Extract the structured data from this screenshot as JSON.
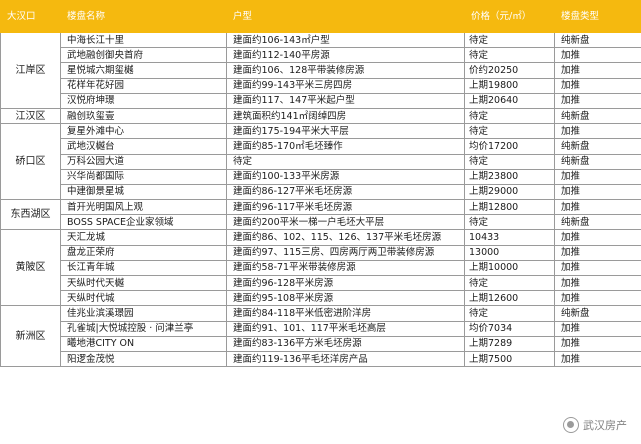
{
  "header": {
    "district": "大汉口",
    "name": "楼盘名称",
    "type": "户型",
    "price": "价格（元/㎡）",
    "category": "楼盘类型"
  },
  "groups": [
    {
      "district": "江岸区",
      "rows": [
        {
          "name": "中海长江十里",
          "type": "建面约106-143㎡户型",
          "price": "待定",
          "category": "纯新盘"
        },
        {
          "name": "武地融创御央首府",
          "type": "建面约112-140平房源",
          "price": "待定",
          "category": "加推"
        },
        {
          "name": "星悦城六期玺樾",
          "type": "建面约106、128平带装修房源",
          "price": "价约20250",
          "category": "加推"
        },
        {
          "name": "花样年花好园",
          "type": "建面约99-143平米三房四房",
          "price": "上期19800",
          "category": "加推"
        },
        {
          "name": "汉悦府坤璟",
          "type": "建面约117、147平米起户型",
          "price": "上期20640",
          "category": "加推"
        }
      ]
    },
    {
      "district": "江汉区",
      "rows": [
        {
          "name": "融创玖玺壹",
          "type": "建筑面积约141㎡阔绰四房",
          "price": "待定",
          "category": "纯新盘"
        }
      ]
    },
    {
      "district": "硚口区",
      "rows": [
        {
          "name": "复星外滩中心",
          "type": "建面约175-194平米大平层",
          "price": "待定",
          "category": "加推"
        },
        {
          "name": "武地汉樾台",
          "type": "建面约85-170㎡毛坯臻作",
          "price": "均价17200",
          "category": "纯新盘"
        },
        {
          "name": "万科公园大道",
          "type": "待定",
          "price": "待定",
          "category": "纯新盘"
        },
        {
          "name": "兴华尚都国际",
          "type": "建面约100-133平米房源",
          "price": "上期23800",
          "category": "加推"
        },
        {
          "name": "中建御景星城",
          "type": "建面约86-127平米毛坯房源",
          "price": "上期29000",
          "category": "加推"
        }
      ]
    },
    {
      "district": "东西湖区",
      "rows": [
        {
          "name": "首开光明国风上观",
          "type": "建面约96-117平米毛坯房源",
          "price": "上期12800",
          "category": "加推"
        },
        {
          "name": "BOSS SPACE企业家领域",
          "type": "建面约200平米一梯一户毛坯大平层",
          "price": "待定",
          "category": "纯新盘"
        }
      ]
    },
    {
      "district": "黄陂区",
      "rows": [
        {
          "name": "天汇龙城",
          "type": "建面约86、102、115、126、137平米毛坯房源",
          "price": "10433",
          "category": "加推"
        },
        {
          "name": "盘龙正荣府",
          "type": "建面约97、115三房、四房两厅两卫带装修房源",
          "price": "13000",
          "category": "加推"
        },
        {
          "name": "长江青年城",
          "type": "建面约58-71平米带装修房源",
          "price": "上期10000",
          "category": "加推"
        },
        {
          "name": "天纵时代天樾",
          "type": "建面约96-128平米房源",
          "price": "待定",
          "category": "加推"
        },
        {
          "name": "天纵时代城",
          "type": "建面约95-108平米房源",
          "price": "上期12600",
          "category": "加推"
        }
      ]
    },
    {
      "district": "新洲区",
      "rows": [
        {
          "name": "佳兆业滨溪璟园",
          "type": "建面约84-118平米低密进阶洋房",
          "price": "待定",
          "category": "纯新盘"
        },
        {
          "name": "孔雀城|大悦城控股 · 问津兰亭",
          "type": "建面约91、101、117平米毛坯高层",
          "price": "均价7034",
          "category": "加推"
        },
        {
          "name": "曦地港CITY ON",
          "type": "建面约83-136平方米毛坯房源",
          "price": "上期7289",
          "category": "加推"
        },
        {
          "name": "阳逻金茂悦",
          "type": "建面约119-136平毛坯洋房产品",
          "price": "上期7500",
          "category": "加推"
        }
      ]
    }
  ],
  "watermark": {
    "text": "武汉房产",
    "icon": "wechat-icon"
  }
}
